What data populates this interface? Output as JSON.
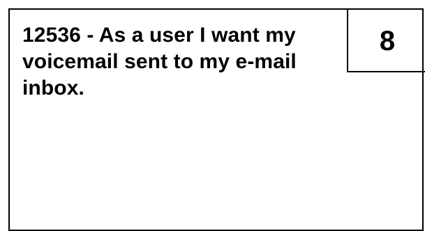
{
  "story_card": {
    "title": "12536 - As a user I want my voicemail sent to my e-mail inbox.",
    "points": "8"
  }
}
